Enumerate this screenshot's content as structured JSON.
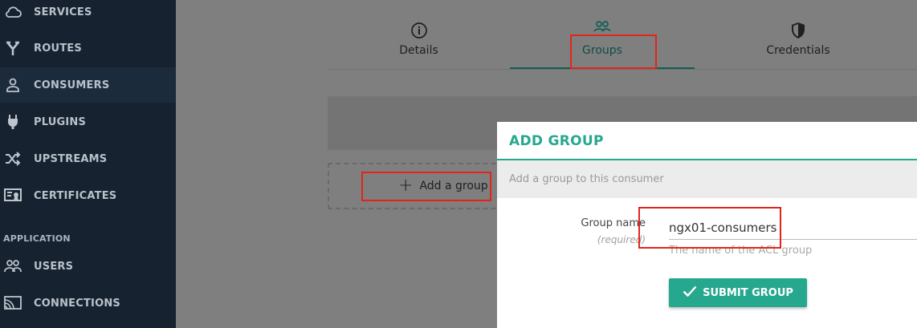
{
  "sidebar": {
    "items": [
      {
        "label": "SERVICES",
        "icon": "cloud-icon"
      },
      {
        "label": "ROUTES",
        "icon": "route-fork-icon"
      },
      {
        "label": "CONSUMERS",
        "icon": "person-icon"
      },
      {
        "label": "PLUGINS",
        "icon": "plug-icon"
      },
      {
        "label": "UPSTREAMS",
        "icon": "shuffle-icon"
      },
      {
        "label": "CERTIFICATES",
        "icon": "certificate-icon"
      }
    ],
    "section": "APPLICATION",
    "app_items": [
      {
        "label": "USERS",
        "icon": "users-icon"
      },
      {
        "label": "CONNECTIONS",
        "icon": "cast-icon"
      }
    ]
  },
  "tabs": [
    {
      "label": "Details",
      "icon": "info-icon"
    },
    {
      "label": "Groups",
      "icon": "group-icon"
    },
    {
      "label": "Credentials",
      "icon": "shield-icon"
    }
  ],
  "add_group_button": "Add a group",
  "modal": {
    "title": "ADD GROUP",
    "subtitle": "Add a group to this consumer",
    "field_label": "Group name",
    "field_required": "(required)",
    "field_value": "ngx01-consumers",
    "field_help": "The name of the ACL group",
    "submit_label": "SUBMIT GROUP"
  },
  "colors": {
    "accent": "#26a88f",
    "sidebar_bg": "#162230",
    "highlight": "#e2251b"
  }
}
